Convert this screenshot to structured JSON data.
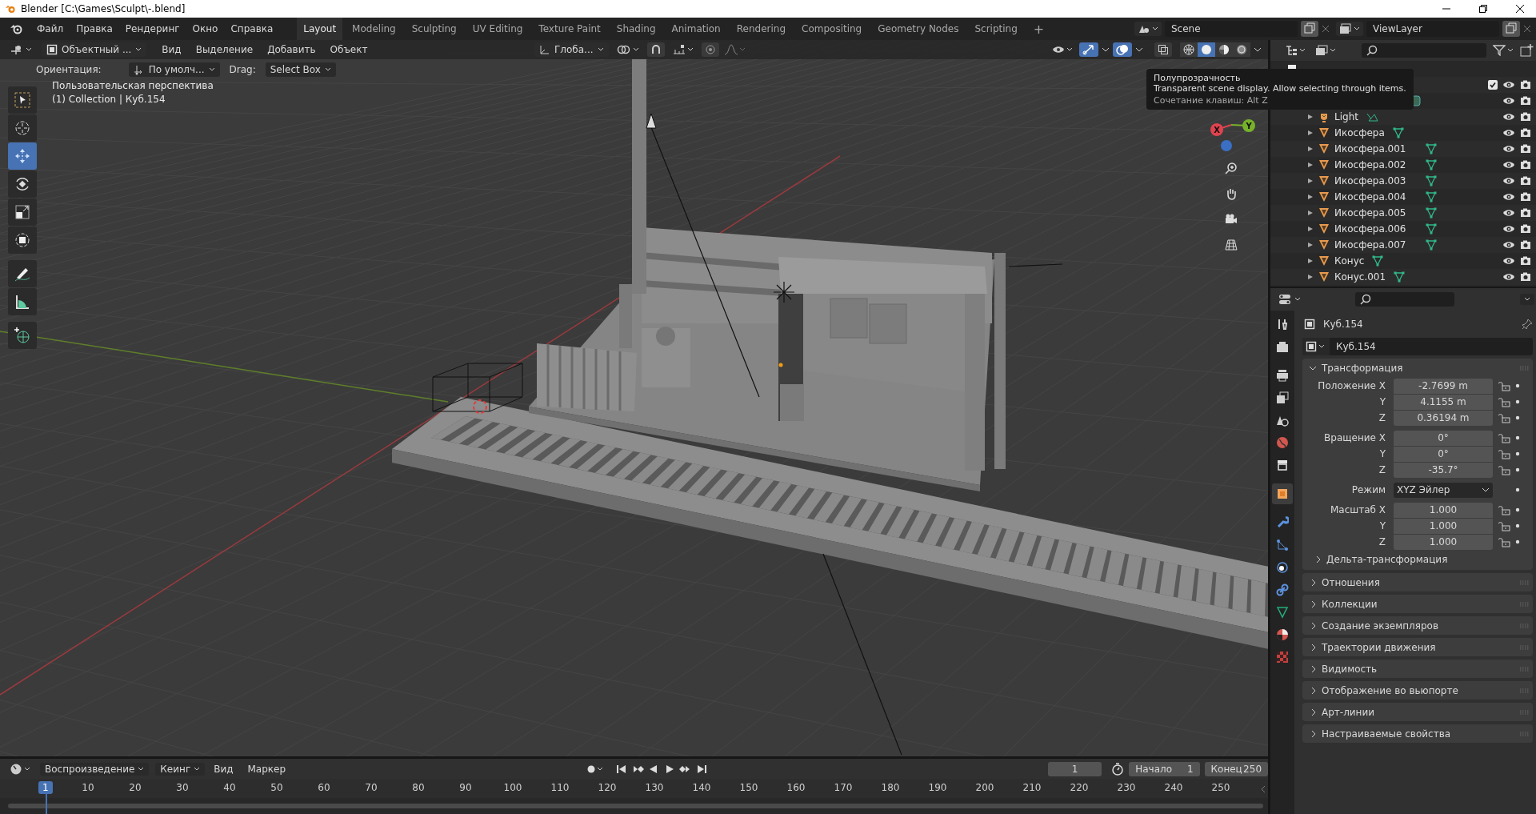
{
  "window": {
    "title": "Blender [C:\\Games\\Sculpt\\-.blend]"
  },
  "menu": [
    "Файл",
    "Правка",
    "Рендеринг",
    "Окно",
    "Справка"
  ],
  "workspaces": [
    {
      "label": "Layout",
      "selected": true
    },
    {
      "label": "Modeling",
      "selected": false
    },
    {
      "label": "Sculpting",
      "selected": false
    },
    {
      "label": "UV Editing",
      "selected": false
    },
    {
      "label": "Texture Paint",
      "selected": false
    },
    {
      "label": "Shading",
      "selected": false
    },
    {
      "label": "Animation",
      "selected": false
    },
    {
      "label": "Rendering",
      "selected": false
    },
    {
      "label": "Compositing",
      "selected": false
    },
    {
      "label": "Geometry Nodes",
      "selected": false
    },
    {
      "label": "Scripting",
      "selected": false
    }
  ],
  "add_workspace": "+",
  "scene": "Scene",
  "view_layer": "ViewLayer",
  "viewport": {
    "mode": "Объектный ...",
    "menus": [
      "Вид",
      "Выделение",
      "Добавить",
      "Объект"
    ],
    "orientation": "Глоба...",
    "gizmos_on": true,
    "overlays_on": true,
    "xray_on": false,
    "shading": [
      {
        "kind": "wireframe",
        "selected": false
      },
      {
        "kind": "solid",
        "selected": true
      },
      {
        "kind": "material",
        "selected": false
      },
      {
        "kind": "rendered",
        "selected": false
      }
    ],
    "tool_settings": {
      "orientation_label": "Ориентация:",
      "orientation": "По умолч...",
      "drag_label": "Drag:",
      "drag": "Select Box"
    },
    "tools": [
      {
        "kind": "select",
        "selected": false
      },
      {
        "kind": "cursor",
        "selected": false
      },
      {
        "kind": "move",
        "selected": true
      },
      {
        "kind": "rotate",
        "selected": false
      },
      {
        "kind": "scale",
        "selected": false
      },
      {
        "kind": "transform",
        "selected": false
      },
      {
        "kind": "annotate",
        "selected": false
      },
      {
        "kind": "measure",
        "selected": false
      },
      {
        "kind": "add",
        "selected": false
      }
    ],
    "view_name": "Пользовательская перспектива",
    "context": "(1) Collection | Куб.154",
    "gizmo": [
      {
        "label": "X",
        "color": "#e0434f"
      },
      {
        "label": "Y",
        "color": "#77b22a"
      },
      {
        "color": "#3b6fc4"
      }
    ]
  },
  "tooltip": {
    "title": "Полупрозрачность",
    "description": "Transparent scene display. Allow selecting through items.",
    "shortcut": "Сочетание клавиш: Alt Z"
  },
  "outliner": {
    "tree": [
      {
        "kind": "scene_collection",
        "children": [
          {
            "kind": "collection",
            "checked": true,
            "children": [
              {
                "kind": "camera"
              },
              {
                "name": "Light",
                "kind": "light"
              },
              {
                "name": "Икосфера",
                "kind": "mesh"
              },
              {
                "name": "Икосфера.001",
                "kind": "mesh"
              },
              {
                "name": "Икосфера.002",
                "kind": "mesh"
              },
              {
                "name": "Икосфера.003",
                "kind": "mesh"
              },
              {
                "name": "Икосфера.004",
                "kind": "mesh"
              },
              {
                "name": "Икосфера.005",
                "kind": "mesh"
              },
              {
                "name": "Икосфера.006",
                "kind": "mesh"
              },
              {
                "name": "Икосфера.007",
                "kind": "mesh"
              },
              {
                "name": "Конус",
                "kind": "mesh"
              },
              {
                "name": "Конус.001",
                "kind": "mesh"
              }
            ]
          }
        ]
      }
    ]
  },
  "properties": {
    "tabs": [
      {
        "kind": "tool",
        "selected": false
      },
      {
        "kind": "render",
        "selected": false
      },
      {
        "kind": "output",
        "selected": false
      },
      {
        "kind": "view_layer",
        "selected": false
      },
      {
        "kind": "scene",
        "selected": false
      },
      {
        "kind": "world",
        "selected": false
      },
      {
        "kind": "collection",
        "selected": false
      },
      {
        "kind": "object",
        "selected": true
      },
      {
        "kind": "modifiers",
        "selected": false
      },
      {
        "kind": "particles",
        "selected": false
      },
      {
        "kind": "physics",
        "selected": false
      },
      {
        "kind": "constraints",
        "selected": false
      },
      {
        "kind": "data",
        "selected": false
      },
      {
        "kind": "material",
        "selected": false
      },
      {
        "kind": "texture",
        "selected": false
      }
    ],
    "object_name": "Куб.154",
    "data_name": "Куб.154",
    "transform_title": "Трансформация",
    "transform_groups": [
      {
        "rows": [
          {
            "label": "Положение X",
            "value": "-2.7699 m",
            "kind": "number"
          },
          {
            "label": "Y",
            "value": "4.1155 m",
            "kind": "number"
          },
          {
            "label": "Z",
            "value": "0.36194 m",
            "kind": "number"
          }
        ]
      },
      {
        "rows": [
          {
            "label": "Вращение X",
            "value": "0°",
            "kind": "number"
          },
          {
            "label": "Y",
            "value": "0°",
            "kind": "number"
          },
          {
            "label": "Z",
            "value": "-35.7°",
            "kind": "number"
          }
        ]
      },
      {
        "rows": [
          {
            "label": "Режим",
            "value": "XYZ Эйлер",
            "kind": "dropdown"
          }
        ]
      },
      {
        "rows": [
          {
            "label": "Масштаб X",
            "value": "1.000",
            "kind": "number"
          },
          {
            "label": "Y",
            "value": "1.000",
            "kind": "number"
          },
          {
            "label": "Z",
            "value": "1.000",
            "kind": "number"
          }
        ]
      }
    ],
    "delta": "Дельта-трансформация",
    "panels": [
      "Отношения",
      "Коллекции",
      "Создание экземпляров",
      "Траектории движения",
      "Видимость",
      "Отображение во вьюпорте",
      "Арт-линии",
      "Настраиваемые свойства"
    ]
  },
  "timeline": {
    "menus": [
      {
        "label": "Воспроизведение",
        "kind": "dropdown"
      },
      {
        "label": "Кеинг",
        "kind": "dropdown"
      },
      {
        "label": "Вид",
        "kind": "menu"
      },
      {
        "label": "Маркер",
        "kind": "menu"
      }
    ],
    "current_frame": "1",
    "start_label": "Начало",
    "start": "1",
    "end_label": "Конец",
    "end": "250",
    "playhead": "1",
    "ruler": [
      "10",
      "20",
      "30",
      "40",
      "50",
      "60",
      "70",
      "80",
      "90",
      "100",
      "110",
      "120",
      "130",
      "140",
      "150",
      "160",
      "170",
      "180",
      "190",
      "200",
      "210",
      "220",
      "230",
      "240",
      "250"
    ]
  }
}
